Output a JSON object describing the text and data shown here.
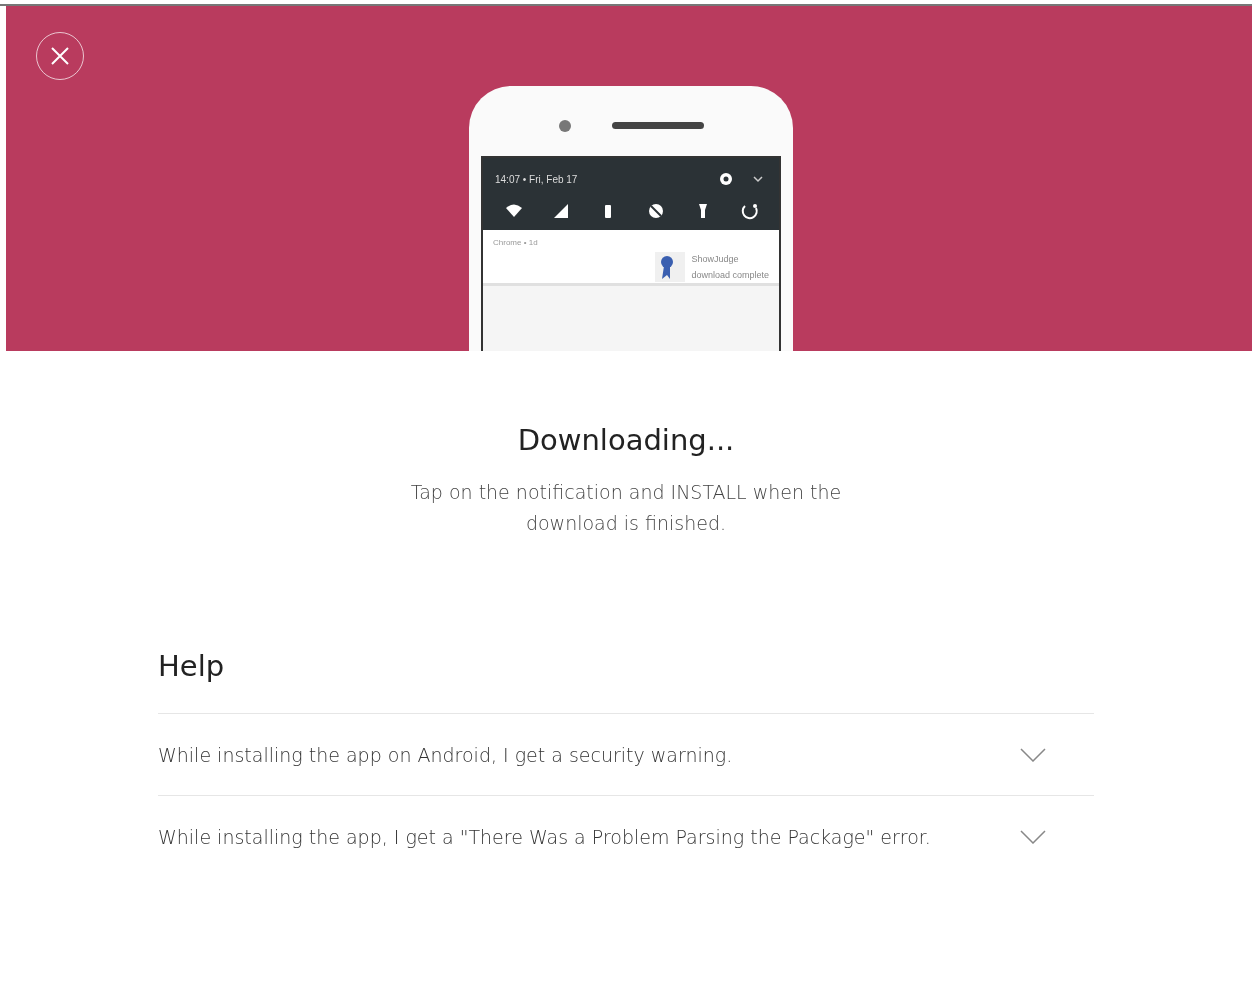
{
  "phone": {
    "status_time": "14:07 • Fri, Feb 17",
    "notification_app": "Chrome • 1d",
    "notification_title": "ShowJudge",
    "notification_text": "download complete"
  },
  "title": "Downloading...",
  "message": "Tap on the notification and INSTALL when the download is finished.",
  "help": {
    "heading": "Help",
    "items": [
      {
        "question": "While installing the app on Android, I get a security warning.",
        "expanded": false
      },
      {
        "question": "While installing the app, I get a \"There Was a Problem Parsing the Package\" error.",
        "expanded": false
      }
    ]
  }
}
